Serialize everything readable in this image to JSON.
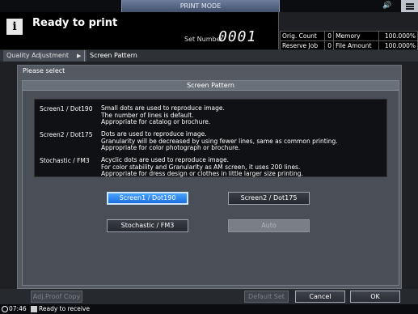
{
  "header": {
    "mode_tab": "PRINT MODE",
    "sound_icon": "speaker-icon",
    "status_title": "Ready to print",
    "set_number_label": "Set Number",
    "set_number_value": "0001"
  },
  "counts": {
    "orig_count_label": "Orig. Count",
    "orig_count_value": "0",
    "memory_label": "Memory",
    "memory_value": "100.000%",
    "reserve_job_label": "Reserve Job",
    "reserve_job_value": "0",
    "file_amount_label": "File Amount",
    "file_amount_value": "100.000%"
  },
  "breadcrumb": {
    "parent": "Quality Adjustment",
    "current": "Screen Pattern"
  },
  "dialog": {
    "please_select": "Please select",
    "panel_title": "Screen Pattern",
    "descriptions": [
      {
        "label": "Screen1 / Dot190",
        "lines": [
          "Small dots are used to reproduce image.",
          "The number of lines is default.",
          "Appropriate for catalog or brochure."
        ]
      },
      {
        "label": "Screen2 / Dot175",
        "lines": [
          "Dots are used to reproduce image.",
          "Granularity will be decreased by using fewer lines, same as common printing.",
          "Appropriate for color photograph or brochure."
        ]
      },
      {
        "label": "Stochastic / FM3",
        "lines": [
          "Acyclic dots are used to reproduce image.",
          "For color stability and Granularity as AM screen, it uses 200 lines.",
          "Appropriate for dress design or clothes in little larger size printing."
        ]
      }
    ],
    "options": {
      "screen1": "Screen1 / Dot190",
      "screen2": "Screen2 / Dot175",
      "stochastic": "Stochastic / FM3",
      "auto": "Auto"
    },
    "selected": "screen1"
  },
  "bottom": {
    "adj_proof": "Adj.Proof Copy",
    "default_set": "Default Set",
    "cancel": "Cancel",
    "ok": "OK"
  },
  "footer": {
    "time": "07:46",
    "status": "Ready to receive"
  }
}
